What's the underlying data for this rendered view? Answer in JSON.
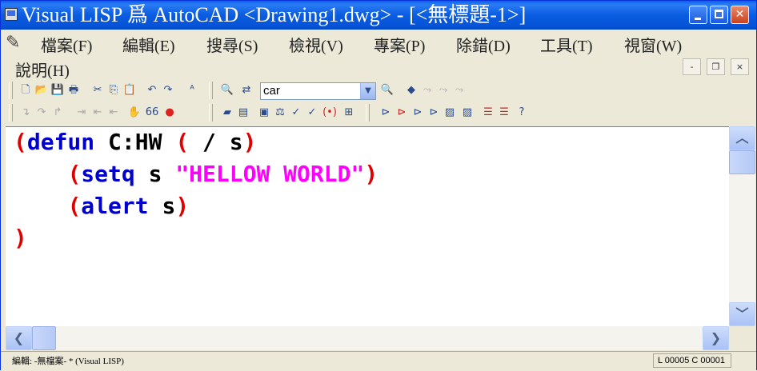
{
  "window": {
    "title": "Visual LISP 爲 AutoCAD <Drawing1.dwg> - [<無標題-1>]",
    "controls": {
      "minimize": "_",
      "maximize": "□",
      "close": "✕"
    }
  },
  "menu": {
    "items": [
      "檔案(F)",
      "編輯(E)",
      "搜尋(S)",
      "檢視(V)",
      "專案(P)",
      "除錯(D)",
      "工具(T)",
      "視窗(W)",
      "說明(H)"
    ],
    "mdi_controls": {
      "minimize": "-",
      "restore": "❐",
      "close": "×"
    }
  },
  "toolbar": {
    "search_value": "car"
  },
  "editor": {
    "lines": [
      [
        {
          "t": "(",
          "c": "p"
        },
        {
          "t": "defun",
          "c": "k"
        },
        {
          "t": " C:HW ",
          "c": "t"
        },
        {
          "t": "(",
          "c": "p"
        },
        {
          "t": " / s",
          "c": "t"
        },
        {
          "t": ")",
          "c": "p"
        }
      ],
      [
        {
          "t": "    ",
          "c": "t"
        },
        {
          "t": "(",
          "c": "p"
        },
        {
          "t": "setq",
          "c": "k"
        },
        {
          "t": " s ",
          "c": "t"
        },
        {
          "t": "\"HELLOW WORLD\"",
          "c": "s"
        },
        {
          "t": ")",
          "c": "p"
        }
      ],
      [
        {
          "t": "    ",
          "c": "t"
        },
        {
          "t": "(",
          "c": "p"
        },
        {
          "t": "alert",
          "c": "k"
        },
        {
          "t": " s",
          "c": "t"
        },
        {
          "t": ")",
          "c": "p"
        }
      ],
      [
        {
          "t": ")",
          "c": "p"
        }
      ]
    ]
  },
  "status": {
    "left": "編輯: -無檔案- * (Visual LISP)",
    "position": "L 00005  C 00001"
  },
  "colors": {
    "paren": "#e00000",
    "keyword": "#0000cc",
    "string": "#ff00ff",
    "titlebar": "#0a5ce0"
  }
}
